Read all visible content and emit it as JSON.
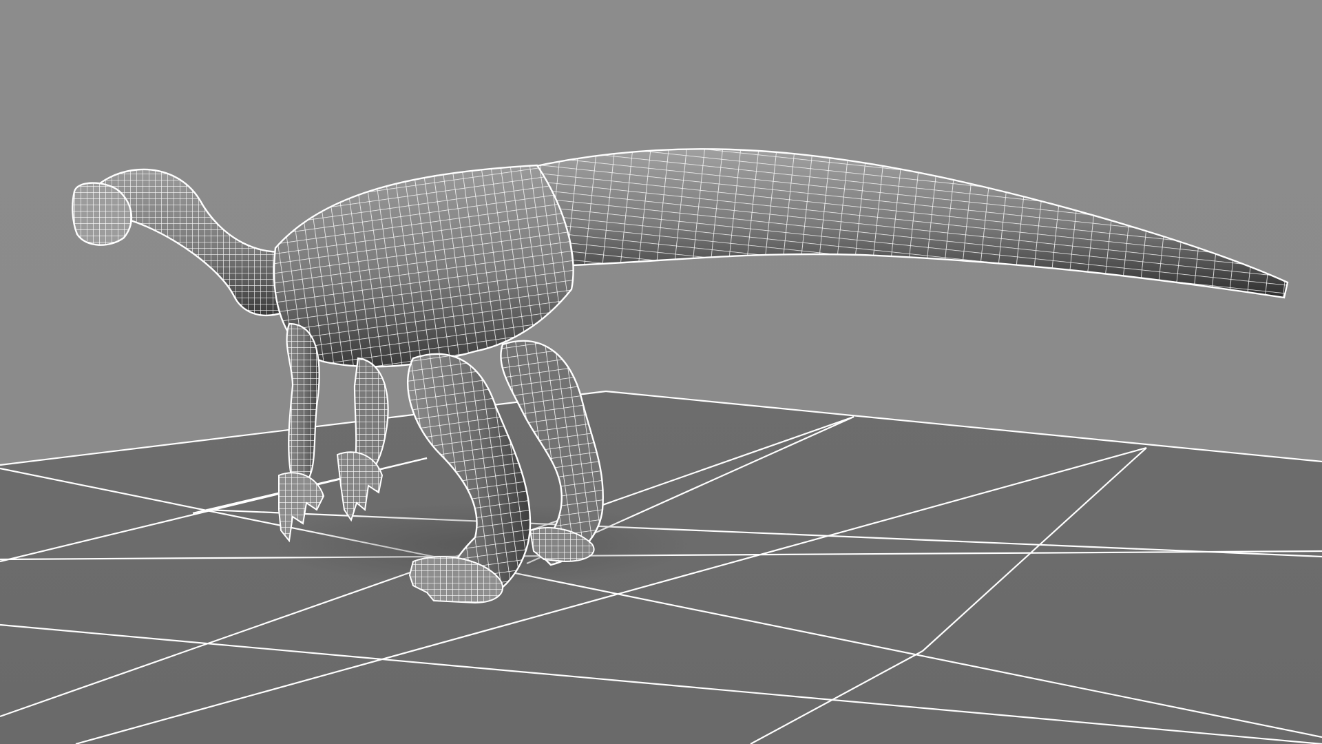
{
  "viewport": {
    "mode": "wireframe-on-shaded",
    "subject": "dinosaur-model-icon",
    "background_color": "#8a8a8a",
    "floor_color": "#6f6f6f",
    "grid_color": "#ffffff",
    "wire_color": "#ffffff",
    "grid_visible": true
  }
}
